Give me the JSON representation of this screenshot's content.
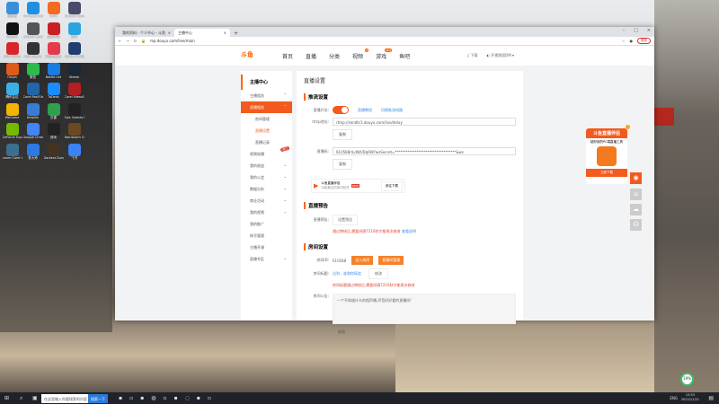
{
  "desktop": {
    "icons": [
      "回收站",
      "Microsoft Edge",
      "2345",
      "Ubisoft Connect",
      "腾讯QQ",
      "Ubisoft Connect",
      "直播伴侣",
      "雷神",
      "WPS Office",
      "OBS Studio",
      "网易云音乐",
      "Adobe Photoshop",
      "Origin",
      "微信",
      "Battle.net",
      "Steam",
      "腾讯会议",
      "Corel FastFlick",
      "ToDesk",
      "Corel VideoStudio",
      "WeGame",
      "Dolphin",
      "迅雷",
      "Epic Games Launcher",
      "GeForce Experience",
      "Google Chrome",
      "剪映",
      "Barnstorm Online",
      "Learn Corel VideoStudio",
      "鲁大师",
      "Darkest Dungeon",
      "飞书"
    ]
  },
  "browser": {
    "tabs": [
      "我的资料 - 个人中心 - 斗鱼",
      "主播中心"
    ],
    "url": "mp.douyu.com/live/main",
    "update_label": "更新"
  },
  "site": {
    "logo": "斗鱼",
    "nav": [
      "首页",
      "直播",
      "分类",
      "视频",
      "游戏",
      "鱼吧"
    ],
    "nav_badge_video": "3",
    "nav_badge_game": "new",
    "download": "下载",
    "username": "开视频君DM"
  },
  "sidebar": {
    "title": "主播中心",
    "items": [
      {
        "label": "主播相关"
      },
      {
        "label": "直播相关"
      },
      {
        "label": "房间管理"
      },
      {
        "label": "直播设置"
      },
      {
        "label": "直播记录"
      },
      {
        "label": "视频轮播"
      },
      {
        "label": "我的收益"
      },
      {
        "label": "我的公会"
      },
      {
        "label": "数据分析"
      },
      {
        "label": "商业活动"
      },
      {
        "label": "我的视频"
      },
      {
        "label": "我的推广"
      },
      {
        "label": "帐号管理"
      },
      {
        "label": "主播开课"
      },
      {
        "label": "直播专区"
      }
    ],
    "hot_badge": "热门"
  },
  "main": {
    "page_title": "直播设置",
    "push": {
      "title": "推流设置",
      "switch_label": "直播开关:",
      "tutorial": "直播教程",
      "switch_line": "切换推流线路",
      "rtmp_label": "rtmp地址:",
      "rtmp_value": "rtmp://sendtc1.douyu.com/live/delay",
      "copy": "复制",
      "code_label": "直播码:",
      "code_value": "610588rlLdWUDq9W?wsSecret=**********************************&ws",
      "copy2": "复制",
      "promo_title": "斗鱼直播伴侣",
      "promo_sub": "功能最全的推流软件",
      "promo_badge": "NEW",
      "promo_btn": "前往下载"
    },
    "notice": {
      "title": "直播预告",
      "label": "直播预告:",
      "btn": "设置预告",
      "warn": "通过审核后,需要间隔7210秒才能再次修改",
      "link": "查看说明"
    },
    "room": {
      "title": "房间设置",
      "id_label": "房间ID:",
      "id_value": "610588",
      "enter_btn": "进入房间",
      "manage_btn": "直播间管理",
      "name_label": "房间标题:",
      "name_value": "达利、谁和你搞笑",
      "modify": "修改",
      "name_warn": "房间标题通过审核后,需要间隔7210秒才能再次修改",
      "announce_label": "房间公告:",
      "announce_value": "一个不知道什么的相声播,声音好好看的直播间!",
      "modify2": "修改"
    }
  },
  "float": {
    "title": "斗鱼直播伴侣",
    "sub": "超好用的PC端直播工具",
    "download": "立即下载"
  },
  "taskbar": {
    "search": "在这里输入你要搜索的内容",
    "search_btn": "搜索一下",
    "lang": "ENG",
    "time": "13:53",
    "date": "2022/11/21",
    "net": "19%"
  }
}
